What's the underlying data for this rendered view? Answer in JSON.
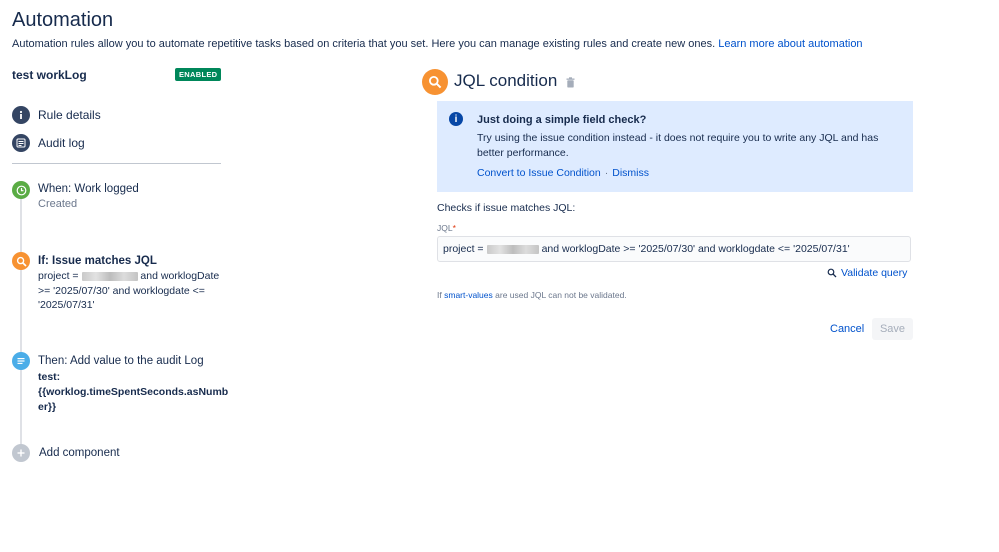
{
  "header": {
    "title": "Automation",
    "intro": "Automation rules allow you to automate repetitive tasks based on criteria that you set. Here you can manage existing rules and create new ones.",
    "learn_more": "Learn more about automation"
  },
  "rule": {
    "name": "test workLog",
    "status": "ENABLED"
  },
  "nav": [
    {
      "label": "Rule details",
      "icon": "info-icon"
    },
    {
      "label": "Audit log",
      "icon": "list-icon"
    }
  ],
  "steps": {
    "trigger": {
      "title": "When: Work logged",
      "sub": "Created",
      "icon": "clock-icon",
      "color": "#5aac44"
    },
    "condition": {
      "title": "If: Issue matches JQL",
      "line1_pre": "project =",
      "line1_post": "and worklogDate",
      "line2": ">= '2025/07/30' and worklogdate <=",
      "line3": "'2025/07/31'",
      "icon": "search-icon",
      "color": "#f79232"
    },
    "action": {
      "title": "Then: Add value to the audit Log",
      "body1": "test:",
      "body2": "{{worklog.timeSpentSeconds.asNumb",
      "body3": "er}}",
      "icon": "list-icon",
      "color": "#4bade8"
    },
    "add": {
      "label": "Add component",
      "icon": "plus-icon"
    }
  },
  "editor": {
    "title": "JQL condition",
    "info": {
      "title": "Just doing a simple field check?",
      "body": "Try using the issue condition instead - it does not require you to write any JQL and has better performance.",
      "convert": "Convert to Issue Condition",
      "dismiss": "Dismiss"
    },
    "checks_label": "Checks if issue matches JQL:",
    "jql_label": "JQL",
    "jql_pre": "project =",
    "jql_post": "and worklogDate >= '2025/07/30' and worklogdate <= '2025/07/31'",
    "validate": "Validate query",
    "note_pre": "If",
    "note_link": "smart-values",
    "note_post": "are used JQL can not be validated.",
    "cancel": "Cancel",
    "save": "Save"
  }
}
